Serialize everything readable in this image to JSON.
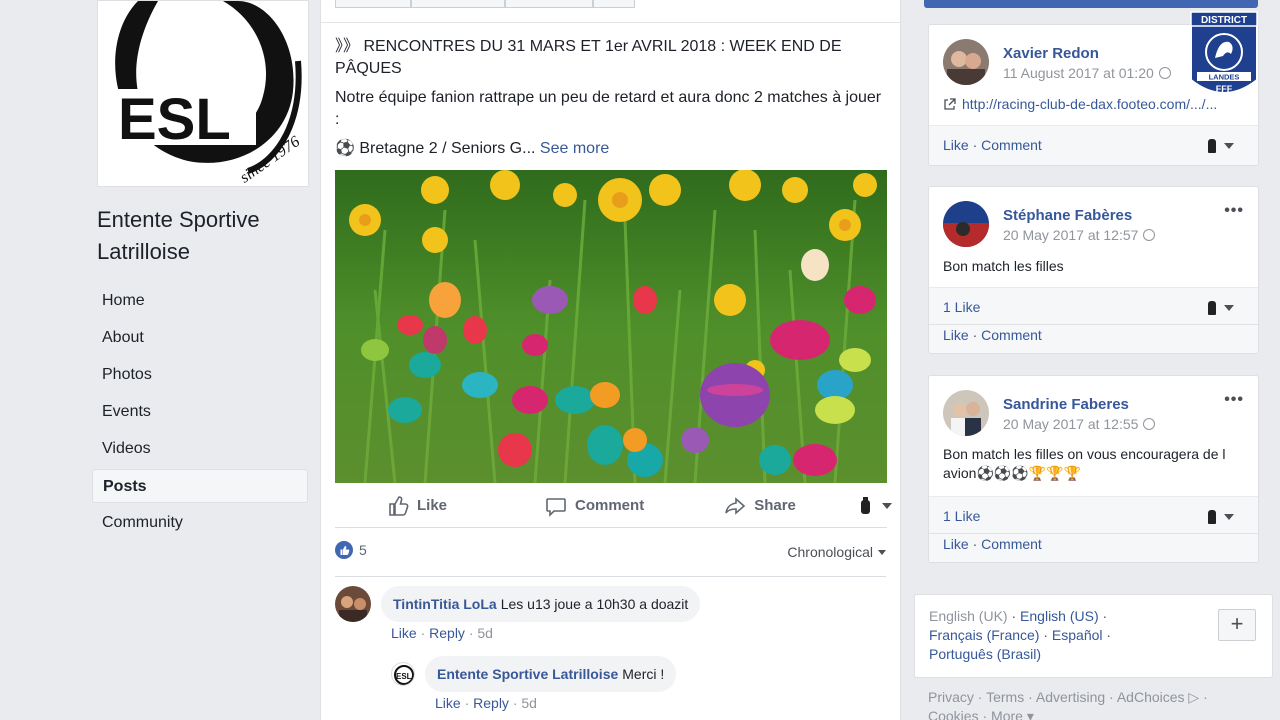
{
  "page": {
    "name": "Entente Sportive Latrilloise",
    "logo_text": "ESL",
    "logo_since": "since 1976"
  },
  "nav": [
    {
      "label": "Home"
    },
    {
      "label": "About"
    },
    {
      "label": "Photos"
    },
    {
      "label": "Events"
    },
    {
      "label": "Videos"
    },
    {
      "label": "Posts",
      "active": true
    },
    {
      "label": "Community"
    }
  ],
  "post": {
    "title": "》》 RENCONTRES DU 31 MARS ET 1er AVRIL 2018 : WEEK END DE PÂQUES",
    "body": "Notre équipe fanion rattrape un peu de retard et aura donc 2 matches à jouer :",
    "teaser": "⚽ Bretagne 2 / Seniors G...",
    "see_more": "See more",
    "actions": {
      "like": "Like",
      "comment": "Comment",
      "share": "Share"
    },
    "like_count": "5",
    "sort_label": "Chronological"
  },
  "comments": [
    {
      "author": "TintinTitia LoLa",
      "text": "Les u13 joue a 10h30 a doazit",
      "like": "Like",
      "reply": "Reply",
      "age": "5d"
    },
    {
      "author": "Entente Sportive Latrilloise",
      "text": "Merci !",
      "like": "Like",
      "reply": "Reply",
      "age": "5d"
    }
  ],
  "sidebar_posts": [
    {
      "name": "Xavier Redon",
      "date": "11 August 2017 at 01:20",
      "link": "http://racing-club-de-dax.footeo.com/.../...",
      "like": "Like",
      "comment": "Comment"
    },
    {
      "name": "Stéphane Fabères",
      "date": "20 May 2017 at 12:57",
      "text": "Bon match les filles",
      "likes": "1 Like",
      "like": "Like",
      "comment": "Comment"
    },
    {
      "name": "Sandrine Faberes",
      "date": "20 May 2017 at 12:55",
      "text": "Bon match les filles on vous encouragera de l avion⚽⚽⚽🏆🏆🏆",
      "likes": "1 Like",
      "like": "Like",
      "comment": "Comment"
    }
  ],
  "languages": {
    "current": "English (UK)",
    "others": [
      "English (US)",
      "Français (France)",
      "Español",
      "Português (Brasil)"
    ]
  },
  "footer": {
    "links": [
      "Privacy",
      "Terms",
      "Advertising",
      "AdChoices",
      "Cookies",
      "More"
    ]
  },
  "badge": {
    "top": "DISTRICT",
    "bottom": "LANDES",
    "org": "FFF"
  },
  "colors": {
    "link": "#385898",
    "like_blue": "#4267b2",
    "bg": "#e9ebee"
  }
}
